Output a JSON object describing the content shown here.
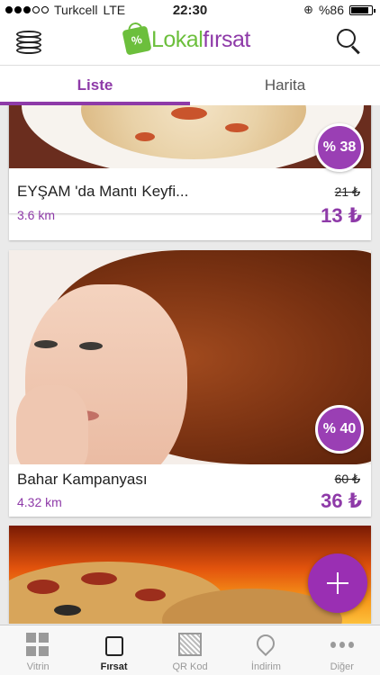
{
  "status_bar": {
    "carrier": "Turkcell",
    "network": "LTE",
    "time": "22:30",
    "battery": "%86",
    "battery_level": 0.86
  },
  "header": {
    "logo_part1": "Lokal",
    "logo_part2": "fırsat",
    "menu_icon": "coins-icon",
    "search_icon": "search-icon"
  },
  "tabs": [
    {
      "label": "Liste",
      "active": true
    },
    {
      "label": "Harita",
      "active": false
    }
  ],
  "deals": [
    {
      "title": "EYŞAM 'da Mantı Keyfi...",
      "distance": "3.6 km",
      "old_price": "21 ₺",
      "price": "13 ₺",
      "discount": "% 38"
    },
    {
      "title": "Bahar Kampanyası",
      "distance": "4.32 km",
      "old_price": "60 ₺",
      "price": "36 ₺",
      "discount": "% 40"
    },
    {
      "title": "",
      "distance": "",
      "old_price": "",
      "price": "",
      "discount": ""
    }
  ],
  "fab": {
    "icon": "plus-icon"
  },
  "bottom_nav": [
    {
      "label": "Vitrin",
      "icon": "grid-icon",
      "active": false
    },
    {
      "label": "Fırsat",
      "icon": "shopping-bag-icon",
      "active": true
    },
    {
      "label": "QR Kod",
      "icon": "qr-code-icon",
      "active": false
    },
    {
      "label": "İndirim",
      "icon": "location-pin-icon",
      "active": false
    },
    {
      "label": "Diğer",
      "icon": "more-dots-icon",
      "active": false
    }
  ],
  "colors": {
    "brand_purple": "#8e3aa8",
    "brand_green": "#6cbf3c"
  }
}
